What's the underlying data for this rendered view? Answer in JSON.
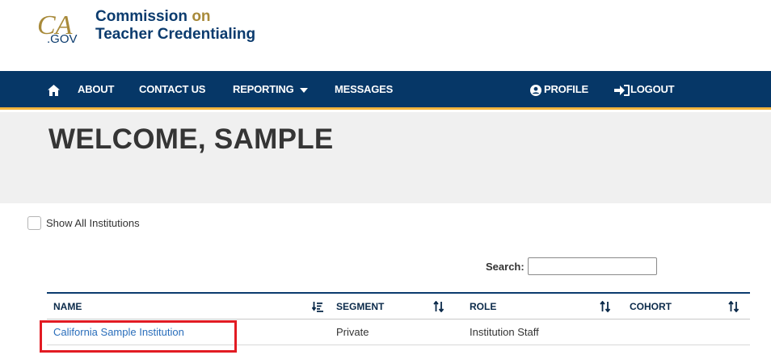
{
  "logo": {
    "ca_mark": "CA",
    "gov": ".GOV",
    "line1_main": "Commission ",
    "line1_accent": "on",
    "line2": "Teacher Credentialing"
  },
  "nav": {
    "home_icon": "home-icon",
    "about": "ABOUT",
    "contact": "CONTACT US",
    "reporting": "REPORTING",
    "messages": "MESSAGES",
    "profile": "PROFILE",
    "logout": "LOGOUT"
  },
  "hero": {
    "title": "WELCOME, SAMPLE"
  },
  "filters": {
    "show_all_label": "Show All Institutions",
    "show_all_checked": false
  },
  "search": {
    "label": "Search:",
    "value": ""
  },
  "table": {
    "headers": {
      "name": "NAME",
      "segment": "SEGMENT",
      "role": "ROLE",
      "cohort": "COHORT"
    },
    "rows": [
      {
        "name": "California Sample Institution",
        "segment": "Private",
        "role": "Institution Staff",
        "cohort": ""
      }
    ]
  },
  "colors": {
    "navbar": "#063767",
    "navbar_border": "#f2b43c",
    "link": "#2a6ebb",
    "highlight": "#e21b23",
    "accent_gold": "#a88a3a"
  }
}
